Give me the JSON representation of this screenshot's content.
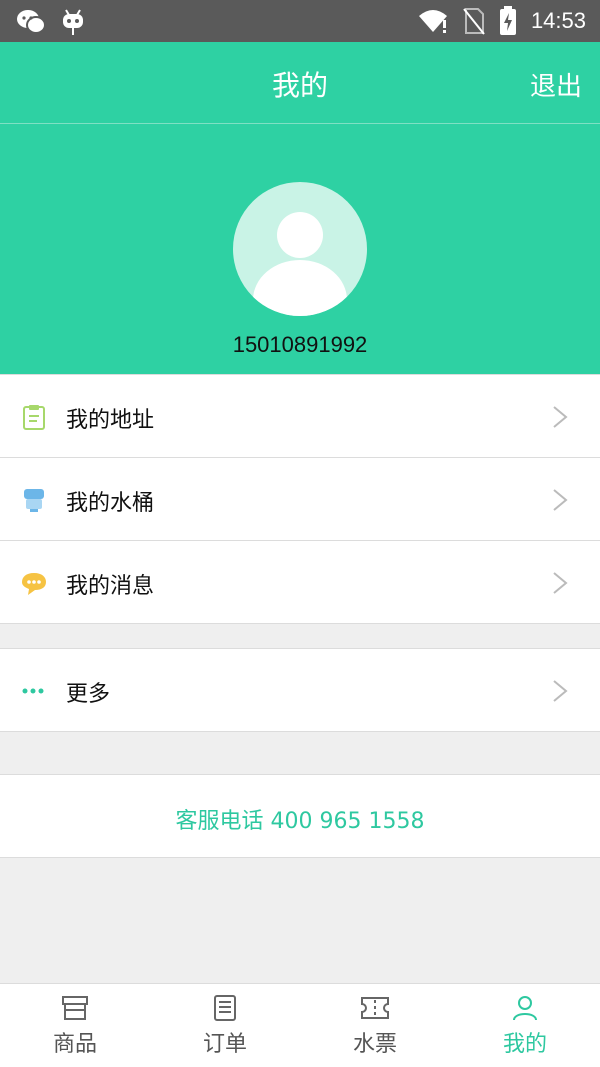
{
  "status_bar": {
    "time": "14:53",
    "left_icons": [
      "wechat-icon",
      "android-debug-icon"
    ],
    "right_icons": [
      "wifi-icon",
      "no-sim-icon",
      "battery-charging-icon"
    ]
  },
  "header": {
    "title": "我的",
    "logout_label": "退出"
  },
  "profile": {
    "phone": "15010891992",
    "avatar_icon": "user-avatar-icon"
  },
  "menu": {
    "items": [
      {
        "label": "我的地址",
        "icon": "clipboard-icon"
      },
      {
        "label": "我的水桶",
        "icon": "water-bucket-icon"
      },
      {
        "label": "我的消息",
        "icon": "message-bubble-icon"
      },
      {
        "label": "更多",
        "icon": "more-dots-icon"
      }
    ]
  },
  "service": {
    "text": "客服电话 400 965 1558"
  },
  "tabbar": {
    "tabs": [
      {
        "label": "商品",
        "icon": "store-icon",
        "active": false
      },
      {
        "label": "订单",
        "icon": "orders-icon",
        "active": false
      },
      {
        "label": "水票",
        "icon": "ticket-icon",
        "active": false
      },
      {
        "label": "我的",
        "icon": "profile-icon",
        "active": true
      }
    ]
  },
  "colors": {
    "primary": "#2ed1a3",
    "accent_text": "#2ec8a0",
    "status_bar": "#5a5a5a",
    "background": "#efefef"
  }
}
